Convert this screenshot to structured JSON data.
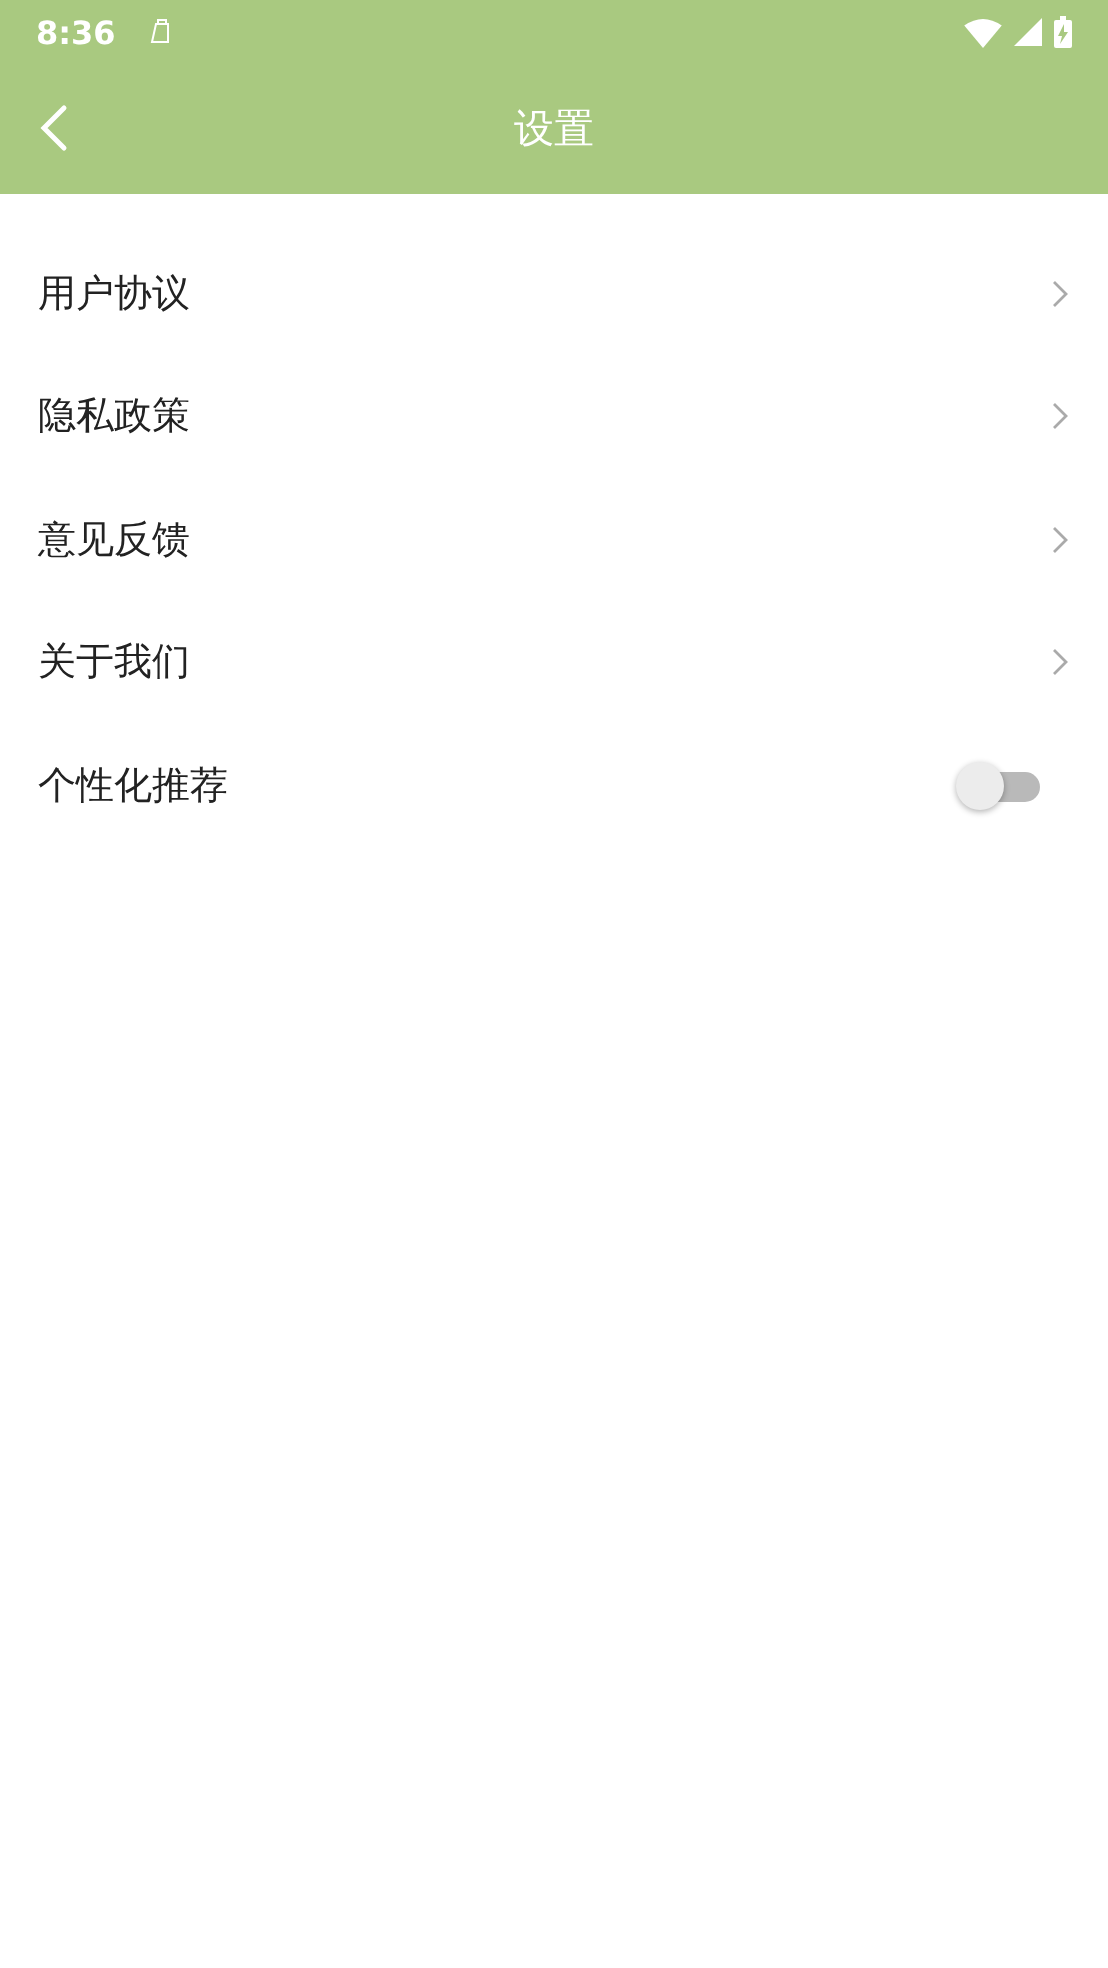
{
  "status_bar": {
    "time": "8:36"
  },
  "header": {
    "title": "设置"
  },
  "items": [
    {
      "kind": "link",
      "label": "用户协议"
    },
    {
      "kind": "link",
      "label": "隐私政策"
    },
    {
      "kind": "link",
      "label": "意见反馈"
    },
    {
      "kind": "link",
      "label": "关于我们"
    },
    {
      "kind": "toggle",
      "label": "个性化推荐",
      "on": false
    }
  ]
}
